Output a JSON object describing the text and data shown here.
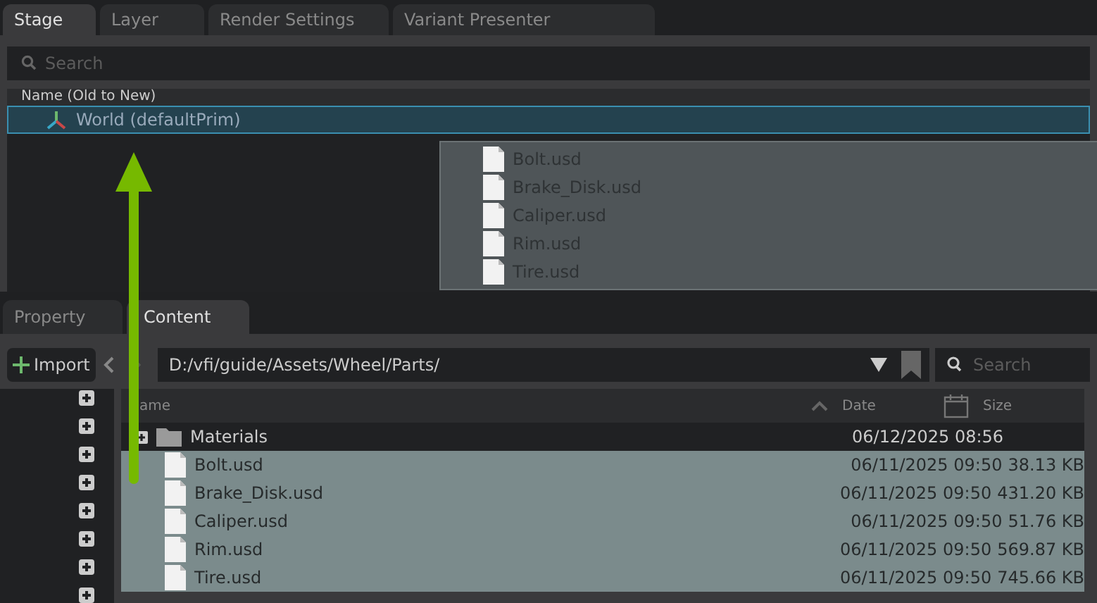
{
  "top_tabs": [
    {
      "label": "Stage",
      "selected": true
    },
    {
      "label": "Layer",
      "selected": false
    },
    {
      "label": "Render Settings",
      "selected": false
    },
    {
      "label": "Variant Presenter",
      "selected": false
    }
  ],
  "stage_search": {
    "placeholder": "Search"
  },
  "stage_tree": {
    "column": "Name (Old to New)",
    "items": [
      {
        "label": "World (defaultPrim)",
        "selected": true
      }
    ]
  },
  "drag_preview": {
    "items": [
      "Bolt.usd",
      "Brake_Disk.usd",
      "Caliper.usd",
      "Rim.usd",
      "Tire.usd"
    ]
  },
  "bottom_tabs": [
    {
      "label": "Property",
      "selected": false
    },
    {
      "label": "Content",
      "selected": true
    }
  ],
  "toolbar": {
    "import": "Import",
    "path": "D:/vfi/guide/Assets/Wheel/Parts/",
    "search": {
      "placeholder": "Search"
    }
  },
  "file_table": {
    "columns": [
      "ame",
      "Date",
      "Size"
    ],
    "rows": [
      {
        "kind": "folder",
        "name": "Materials",
        "date": "06/12/2025 08:56",
        "selected": false
      },
      {
        "kind": "file",
        "name": "Bolt.usd",
        "date": "06/11/2025 09:50",
        "size": "38.13 KB",
        "selected": true
      },
      {
        "kind": "file",
        "name": "Brake_Disk.usd",
        "date": "06/11/2025 09:50",
        "size": "431.20 KB",
        "selected": true
      },
      {
        "kind": "file",
        "name": "Caliper.usd",
        "date": "06/11/2025 09:50",
        "size": "51.76 KB",
        "selected": true
      },
      {
        "kind": "file",
        "name": "Rim.usd",
        "date": "06/11/2025 09:50",
        "size": "569.87 KB",
        "selected": true
      },
      {
        "kind": "file",
        "name": "Tire.usd",
        "date": "06/11/2025 09:50",
        "size": "745.66 KB",
        "selected": true
      }
    ]
  }
}
